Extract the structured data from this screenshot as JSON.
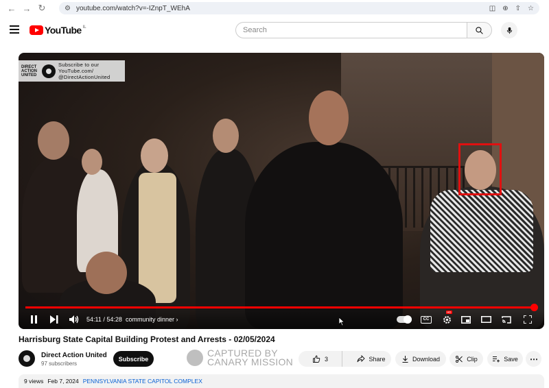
{
  "browser": {
    "url": "youtube.com/watch?v=-IZnpT_WEhA"
  },
  "header": {
    "logo_text": "YouTube",
    "logo_sup": "IL",
    "search_placeholder": "Search"
  },
  "video": {
    "watermark_logo": "DIRECT ACTION UNITED",
    "watermark_line1": "Subscribe to our",
    "watermark_line2": "YouTube.com/",
    "watermark_line3": "@DirectActionUnited",
    "current_time": "54:11",
    "duration": "54:28",
    "time_display": "54:11 / 54:28",
    "chapter": "community dinner",
    "progress": 0.995,
    "hd_badge": "HD"
  },
  "meta": {
    "title": "Harrisburg State Capital Building Protest and Arrests - 02/05/2024",
    "channel_name": "Direct Action United",
    "subscribers": "97 subscribers",
    "subscribe_label": "Subscribe",
    "overlay_line1": "CAPTURED BY",
    "overlay_line2": "CANARY MISSION",
    "like_count": "3",
    "share_label": "Share",
    "download_label": "Download",
    "clip_label": "Clip",
    "save_label": "Save",
    "views": "9 views",
    "date": "Feb 7, 2024",
    "location_tag": "PENNSYLVANIA STATE CAPITOL COMPLEX"
  },
  "colors": {
    "accent": "#ff0000",
    "highlight_box": "#e01010",
    "link": "#065fd4"
  }
}
